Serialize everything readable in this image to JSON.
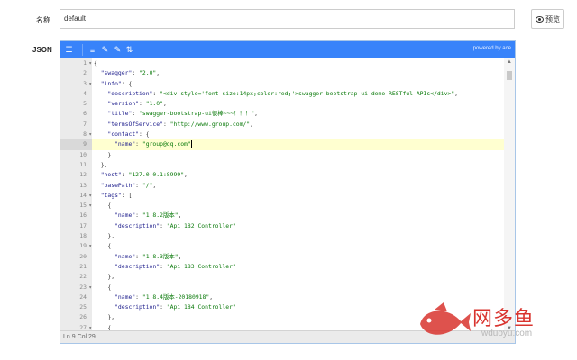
{
  "form": {
    "name_label": "名称",
    "name_value": "default",
    "json_label": "JSON",
    "preview_label": "预览"
  },
  "editor": {
    "powered_by": "powered by ace",
    "status": "Ln 9   Col 29",
    "gutter": [
      {
        "n": "1",
        "fold": true
      },
      {
        "n": "2"
      },
      {
        "n": "3",
        "fold": true
      },
      {
        "n": "4"
      },
      {
        "n": "5"
      },
      {
        "n": "6"
      },
      {
        "n": "7"
      },
      {
        "n": "8",
        "fold": true
      },
      {
        "n": "9",
        "active": true
      },
      {
        "n": "10"
      },
      {
        "n": "11"
      },
      {
        "n": "12"
      },
      {
        "n": "13"
      },
      {
        "n": "14",
        "fold": true
      },
      {
        "n": "15",
        "fold": true
      },
      {
        "n": "16"
      },
      {
        "n": "17"
      },
      {
        "n": "18"
      },
      {
        "n": "19",
        "fold": true
      },
      {
        "n": "20"
      },
      {
        "n": "21"
      },
      {
        "n": "22"
      },
      {
        "n": "23",
        "fold": true
      },
      {
        "n": "24"
      },
      {
        "n": "25"
      },
      {
        "n": "26"
      },
      {
        "n": "27",
        "fold": true
      }
    ],
    "lines": [
      [
        {
          "t": "{",
          "c": "p"
        }
      ],
      [
        {
          "t": "  \"swagger\"",
          "c": "k"
        },
        {
          "t": ": ",
          "c": "p"
        },
        {
          "t": "\"2.0\"",
          "c": "s"
        },
        {
          "t": ",",
          "c": "p"
        }
      ],
      [
        {
          "t": "  \"info\"",
          "c": "k"
        },
        {
          "t": ": {",
          "c": "p"
        }
      ],
      [
        {
          "t": "    \"description\"",
          "c": "k"
        },
        {
          "t": ": ",
          "c": "p"
        },
        {
          "t": "\"<div style='font-size:14px;color:red;'>swagger-bootstrap-ui-demo RESTful APIs</div>\"",
          "c": "s"
        },
        {
          "t": ",",
          "c": "p"
        }
      ],
      [
        {
          "t": "    \"version\"",
          "c": "k"
        },
        {
          "t": ": ",
          "c": "p"
        },
        {
          "t": "\"1.0\"",
          "c": "s"
        },
        {
          "t": ",",
          "c": "p"
        }
      ],
      [
        {
          "t": "    \"title\"",
          "c": "k"
        },
        {
          "t": ": ",
          "c": "p"
        },
        {
          "t": "\"swagger-bootstrap-ui很棒~~~！！！\"",
          "c": "s"
        },
        {
          "t": ",",
          "c": "p"
        }
      ],
      [
        {
          "t": "    \"termsOfService\"",
          "c": "k"
        },
        {
          "t": ": ",
          "c": "p"
        },
        {
          "t": "\"http://www.group.com/\"",
          "c": "s"
        },
        {
          "t": ",",
          "c": "p"
        }
      ],
      [
        {
          "t": "    \"contact\"",
          "c": "k"
        },
        {
          "t": ": {",
          "c": "p"
        }
      ],
      [
        {
          "t": "      \"name\"",
          "c": "k"
        },
        {
          "t": ": ",
          "c": "p"
        },
        {
          "t": "\"group@qq.com\"",
          "c": "s"
        }
      ],
      [
        {
          "t": "    }",
          "c": "p"
        }
      ],
      [
        {
          "t": "  },",
          "c": "p"
        }
      ],
      [
        {
          "t": "  \"host\"",
          "c": "k"
        },
        {
          "t": ": ",
          "c": "p"
        },
        {
          "t": "\"127.0.0.1:8999\"",
          "c": "s"
        },
        {
          "t": ",",
          "c": "p"
        }
      ],
      [
        {
          "t": "  \"basePath\"",
          "c": "k"
        },
        {
          "t": ": ",
          "c": "p"
        },
        {
          "t": "\"/\"",
          "c": "s"
        },
        {
          "t": ",",
          "c": "p"
        }
      ],
      [
        {
          "t": "  \"tags\"",
          "c": "k"
        },
        {
          "t": ": [",
          "c": "p"
        }
      ],
      [
        {
          "t": "    {",
          "c": "p"
        }
      ],
      [
        {
          "t": "      \"name\"",
          "c": "k"
        },
        {
          "t": ": ",
          "c": "p"
        },
        {
          "t": "\"1.8.2版本\"",
          "c": "s"
        },
        {
          "t": ",",
          "c": "p"
        }
      ],
      [
        {
          "t": "      \"description\"",
          "c": "k"
        },
        {
          "t": ": ",
          "c": "p"
        },
        {
          "t": "\"Api 182 Controller\"",
          "c": "s"
        }
      ],
      [
        {
          "t": "    },",
          "c": "p"
        }
      ],
      [
        {
          "t": "    {",
          "c": "p"
        }
      ],
      [
        {
          "t": "      \"name\"",
          "c": "k"
        },
        {
          "t": ": ",
          "c": "p"
        },
        {
          "t": "\"1.8.3版本\"",
          "c": "s"
        },
        {
          "t": ",",
          "c": "p"
        }
      ],
      [
        {
          "t": "      \"description\"",
          "c": "k"
        },
        {
          "t": ": ",
          "c": "p"
        },
        {
          "t": "\"Api 183 Controller\"",
          "c": "s"
        }
      ],
      [
        {
          "t": "    },",
          "c": "p"
        }
      ],
      [
        {
          "t": "    {",
          "c": "p"
        }
      ],
      [
        {
          "t": "      \"name\"",
          "c": "k"
        },
        {
          "t": ": ",
          "c": "p"
        },
        {
          "t": "\"1.8.4版本-20180918\"",
          "c": "s"
        },
        {
          "t": ",",
          "c": "p"
        }
      ],
      [
        {
          "t": "      \"description\"",
          "c": "k"
        },
        {
          "t": ": ",
          "c": "p"
        },
        {
          "t": "\"Api 184 Controller\"",
          "c": "s"
        }
      ],
      [
        {
          "t": "    },",
          "c": "p"
        }
      ],
      [
        {
          "t": "    {",
          "c": "p"
        }
      ]
    ]
  },
  "watermark": {
    "brand": "网多鱼",
    "site": "wduoyu.com",
    "color": "#d9342f"
  }
}
